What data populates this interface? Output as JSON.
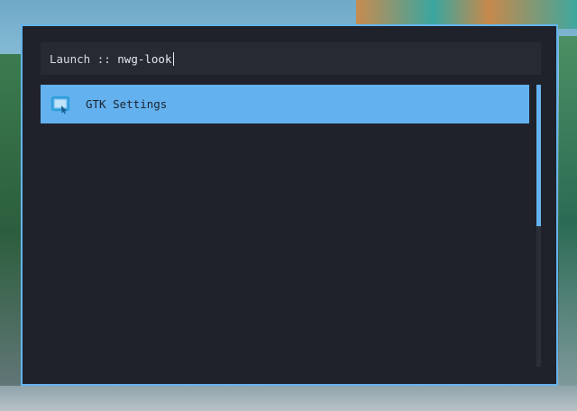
{
  "launcher": {
    "prompt": "Launch",
    "separator": "::",
    "query": "nwg-look",
    "results": [
      {
        "label": "GTK Settings",
        "icon": "settings-window-icon",
        "selected": true
      }
    ],
    "scroll_fraction_visible": 0.5
  },
  "colors": {
    "accent": "#63b1ee",
    "background": "#1f222a",
    "input_background": "#272a32",
    "text": "#e8ebf0"
  }
}
